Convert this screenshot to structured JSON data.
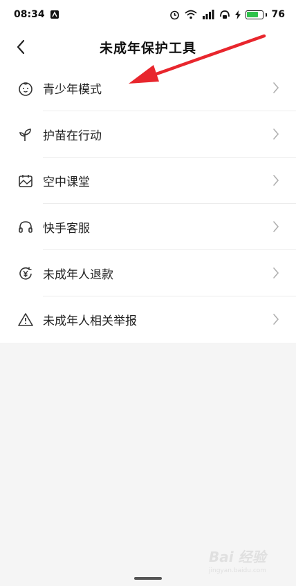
{
  "status_bar": {
    "time": "08:34",
    "battery_level": "76",
    "battery_fraction": 0.76,
    "icons": [
      "notification-app-icon",
      "alarm-icon",
      "wifi-icon",
      "signal-icon",
      "hotspot-icon",
      "charging-icon"
    ]
  },
  "header": {
    "title": "未成年保护工具"
  },
  "menu": {
    "items": [
      {
        "label": "青少年模式",
        "icon": "child-face-icon"
      },
      {
        "label": "护苗在行动",
        "icon": "sprout-icon"
      },
      {
        "label": "空中课堂",
        "icon": "classroom-icon"
      },
      {
        "label": "快手客服",
        "icon": "headset-icon"
      },
      {
        "label": "未成年人退款",
        "icon": "refund-yen-icon"
      },
      {
        "label": "未成年人相关举报",
        "icon": "warning-icon"
      }
    ]
  },
  "annotation": {
    "color": "#e8262d"
  },
  "watermark": {
    "text": "Bai 经验",
    "sub": "jingyan.baidu.com"
  }
}
